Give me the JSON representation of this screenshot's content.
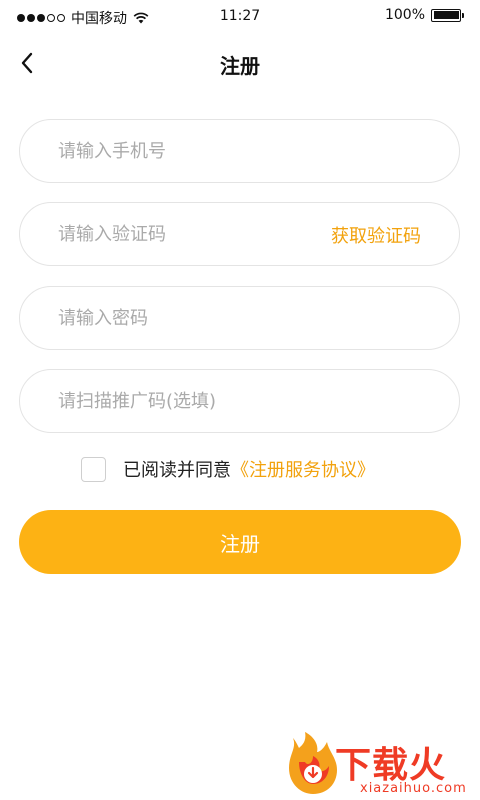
{
  "status_bar": {
    "carrier": "中国移动",
    "time": "11:27",
    "battery": "100%",
    "battery_level": 1.0,
    "signal_dots_filled": 3,
    "signal_dots_total": 5
  },
  "nav": {
    "title": "注册",
    "back_icon": "chevron-left-icon"
  },
  "form": {
    "phone_placeholder": "请输入手机号",
    "code_placeholder": "请输入验证码",
    "get_code_label": "获取验证码",
    "password_placeholder": "请输入密码",
    "promo_placeholder": "请扫描推广码(选填)"
  },
  "agreement": {
    "text": "已阅读并同意",
    "link": "《注册服务协议》",
    "checked": false
  },
  "submit_label": "注册",
  "watermark": {
    "title": "下载火",
    "subtitle": "xiazaihuo.com"
  },
  "colors": {
    "accent": "#f2a20d",
    "button": "#fdb214",
    "watermark": "#ef3b25"
  }
}
